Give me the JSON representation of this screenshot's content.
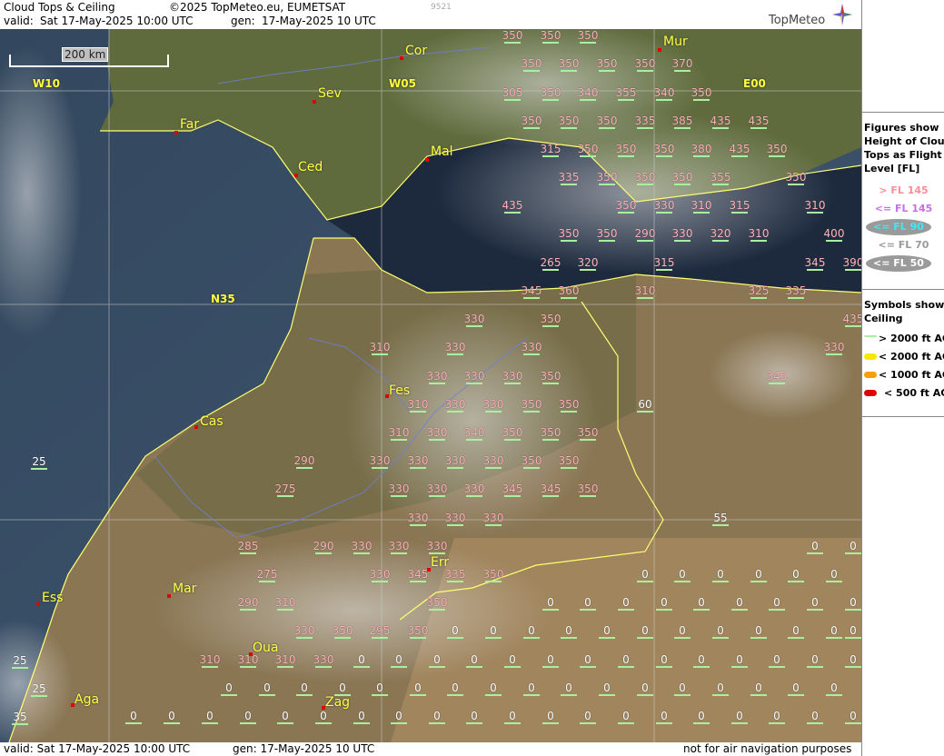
{
  "header": {
    "title": "Cloud Tops & Ceiling",
    "copyright": "©2025 TopMeteo.eu, EUMETSAT",
    "code": "9521",
    "valid_label": "valid:",
    "valid_value": "Sat  17-May-2025  10:00 UTC",
    "gen_label": "gen:",
    "gen_value": "17-May-2025 10 UTC",
    "logo": "TopMeteo"
  },
  "footer": {
    "valid": "valid:  Sat  17-May-2025  10:00 UTC",
    "gen": "gen: 17-May-2025 10 UTC",
    "disclaimer": "not for air navigation purposes"
  },
  "map": {
    "scale_label": "200 km",
    "grid_labels": [
      "W10",
      "W05",
      "E00",
      "N35"
    ],
    "cities": [
      "Cor",
      "Mur",
      "Sev",
      "Far",
      "Ced",
      "Mal",
      "Fes",
      "Cas",
      "Err",
      "Ess",
      "Mar",
      "Oua",
      "Aga",
      "Zag"
    ],
    "flight_levels": [
      "350",
      "350",
      "350",
      "350",
      "350",
      "350",
      "350",
      "370",
      "305",
      "350",
      "340",
      "355",
      "340",
      "350",
      "350",
      "350",
      "350",
      "335",
      "385",
      "435",
      "435",
      "315",
      "350",
      "350",
      "350",
      "380",
      "435",
      "350",
      "335",
      "350",
      "350",
      "350",
      "355",
      "350",
      "435",
      "350",
      "330",
      "310",
      "315",
      "310",
      "350",
      "350",
      "290",
      "330",
      "320",
      "310",
      "400",
      "265",
      "320",
      "315",
      "345",
      "390",
      "345",
      "360",
      "310",
      "325",
      "335",
      "330",
      "350",
      "435",
      "310",
      "330",
      "330",
      "330",
      "330",
      "330",
      "330",
      "350",
      "345",
      "310",
      "330",
      "330",
      "350",
      "350",
      "60",
      "310",
      "330",
      "340",
      "350",
      "350",
      "350",
      "290",
      "330",
      "330",
      "330",
      "330",
      "350",
      "350",
      "275",
      "330",
      "330",
      "330",
      "345",
      "345",
      "350",
      "330",
      "330",
      "330",
      "55",
      "285",
      "290",
      "330",
      "330",
      "330",
      "275",
      "330",
      "345",
      "335",
      "350",
      "290",
      "310",
      "350",
      "330",
      "350",
      "295",
      "350",
      "310",
      "310",
      "310",
      "330"
    ],
    "ceiling_values": [
      "25",
      "25",
      "25",
      "35",
      "0"
    ]
  },
  "sidebar": {
    "figures_title": [
      "Figures show",
      "Height of Cloud",
      "Tops as Flight",
      "Level  [FL]"
    ],
    "legend": [
      {
        "label": "> FL 145",
        "color": "#ff8c9a"
      },
      {
        "label": "<= FL 145",
        "color": "#c86ee8"
      },
      {
        "label": "<= FL 90",
        "color": "#40e8f0"
      },
      {
        "label": "<= FL 70",
        "color": "#9a9a9a"
      },
      {
        "label": "<= FL 50",
        "color": "#ffffff"
      }
    ],
    "symbols_title": [
      "Symbols show",
      "Ceiling"
    ],
    "symbols": [
      {
        "label": "> 2000 ft AGL",
        "color": "#a8f0a0"
      },
      {
        "label": "< 2000 ft AGL",
        "color": "#f8e800"
      },
      {
        "label": "< 1000 ft AGL",
        "color": "#f8a000"
      },
      {
        "label": "< 500 ft AGL",
        "color": "#e00000"
      }
    ]
  }
}
